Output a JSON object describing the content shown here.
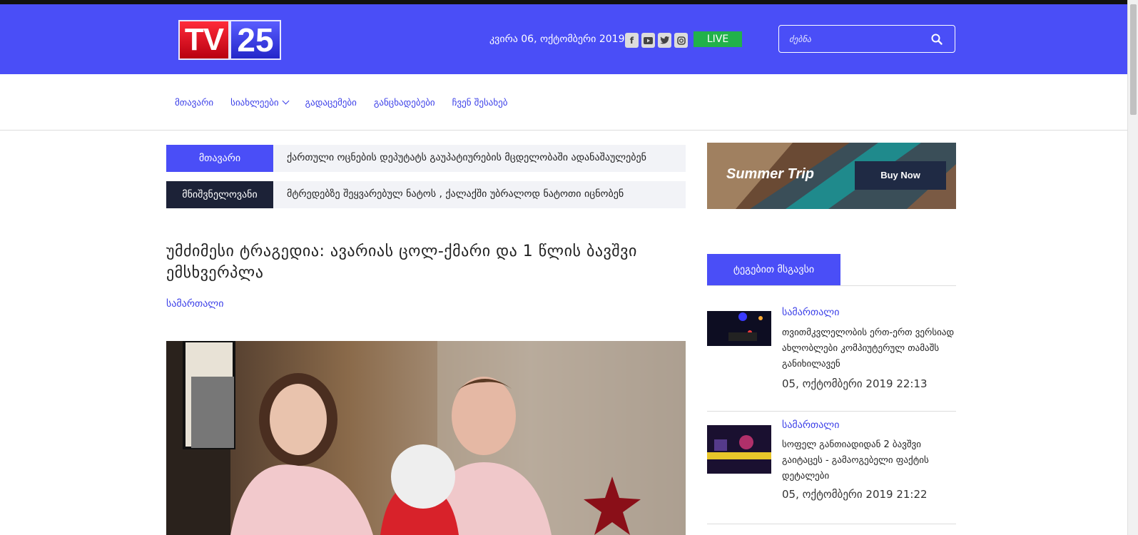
{
  "header": {
    "logo_tv": "TV",
    "logo_num": "25",
    "date": "კვირა 06, ოქტომბერი 2019",
    "social": [
      "facebook-icon",
      "youtube-icon",
      "twitter-icon",
      "instagram-icon"
    ],
    "live_label": "LIVE",
    "search_placeholder": "ძებნა"
  },
  "nav": {
    "items": [
      "მთავარი",
      "სიახლეები",
      "გადაცემები",
      "განცხადებები",
      "ჩვენ შესახებ"
    ]
  },
  "ticker": [
    {
      "label": "მთავარი",
      "text": "ქართული ოცნების დეპუტატს გაუპატიურების მცდელობაში ადანაშაულებენ",
      "color": "#4a4ef7"
    },
    {
      "label": "მნიშვნელოვანი",
      "text": "მტრედებზე შეყვარებულ ნატოს , ქალაქში უბრალოდ ნატოთი იცნობენ",
      "color": "#1c2237"
    }
  ],
  "article": {
    "title": "უმძიმესი ტრაგედია: ავარიას ცოლ-ქმარი და 1 წლის ბავშვი ემსხვერპლა",
    "category": "სამართალი"
  },
  "ad": {
    "title": "Summer Trip",
    "button": "Buy Now"
  },
  "sidebar": {
    "tags_heading": "ტეგებით მსგავსი",
    "news": [
      {
        "category": "სამართალი",
        "title": "თვითმკვლელობის ერთ-ერთ ვერსიად ახლობლები კომპიუტერულ თამაშს განიხილავენ",
        "date": "05, ოქტომბერი 2019 22:13"
      },
      {
        "category": "სამართალი",
        "title": "სოფელ განთიადიდან 2 ბავშვი გაიტაცეს - გამაოგებელი ფაქტის დეტალები",
        "date": "05, ოქტომბერი 2019 21:22"
      }
    ]
  },
  "colors": {
    "brand": "#4a4ef7",
    "live": "#21b14a",
    "dark_label": "#1c2237"
  }
}
